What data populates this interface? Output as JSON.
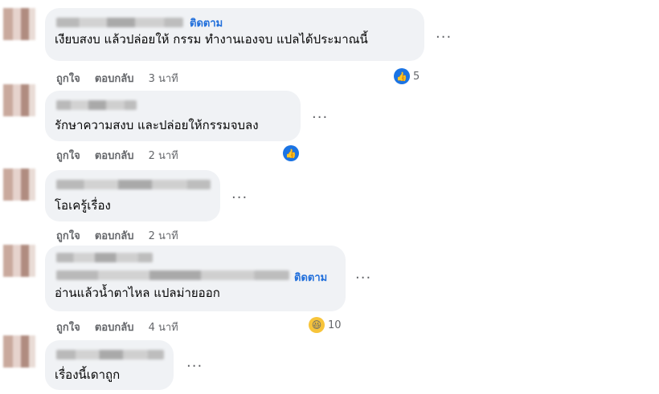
{
  "comments": [
    {
      "follow_label": "ติดตาม",
      "text": "เงียบสงบ แล้วปล่อยให้ กรรม ทำงานเองจบ แปลได้ประมาณนี้",
      "more": "···",
      "actions": {
        "like": "ถูกใจ",
        "reply": "ตอบกลับ",
        "time": "3 นาที"
      },
      "reaction": {
        "icon": "like-icon",
        "count": "5"
      }
    },
    {
      "text": "รักษาความสงบ และปล่อยให้กรรมจบลง",
      "more": "···",
      "actions": {
        "like": "ถูกใจ",
        "reply": "ตอบกลับ",
        "time": "2 นาที"
      },
      "reaction": {
        "icon": "like-icon",
        "count": ""
      }
    },
    {
      "text": "โอเครู้เรื่อง",
      "more": "···",
      "actions": {
        "like": "ถูกใจ",
        "reply": "ตอบกลับ",
        "time": "2 นาที"
      }
    },
    {
      "follow_label": "ติดตาม",
      "text": "อ่านแล้วน้ำตาไหล แปลม่ายออก",
      "more": "···",
      "actions": {
        "like": "ถูกใจ",
        "reply": "ตอบกลับ",
        "time": "4 นาที"
      },
      "reaction": {
        "icon": "haha-icon",
        "count": "10"
      }
    },
    {
      "text": "เรื่องนี้เดาถูก",
      "more": "···"
    }
  ],
  "colors": {
    "bubble": "#f0f2f5",
    "link": "#216fdb",
    "like": "#1b74e4",
    "meta": "#65676b"
  }
}
